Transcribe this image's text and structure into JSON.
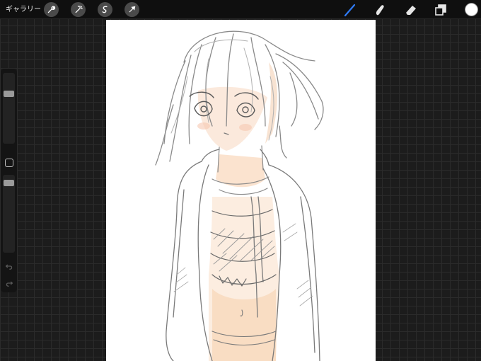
{
  "app": {
    "gallery_label": "ギャラリー"
  },
  "toolbar_left": [
    {
      "name": "actions-icon",
      "icon": "wrench"
    },
    {
      "name": "adjustments-icon",
      "icon": "magic-wand"
    },
    {
      "name": "selection-icon",
      "icon": "s-curve"
    },
    {
      "name": "transform-icon",
      "icon": "arrow"
    }
  ],
  "toolbar_right": [
    {
      "name": "brush-icon",
      "icon": "brush",
      "active": true
    },
    {
      "name": "smudge-icon",
      "icon": "smudge",
      "active": false
    },
    {
      "name": "eraser-icon",
      "icon": "eraser",
      "active": false
    },
    {
      "name": "layers-icon",
      "icon": "layers",
      "active": false
    }
  ],
  "colors": {
    "active_tool": "#2f7bf6",
    "inactive_tool": "#e6e6e6",
    "current_color": "#ffffff",
    "panel_bg": "#0f0f0f",
    "workspace_bg": "#1c1c1c",
    "canvas_bg": "#ffffff"
  },
  "sidebar": {
    "brush_size_level": 0.72,
    "opacity_level": 0.93
  },
  "canvas": {
    "content": "sketch-of-anime-girl-with-hoodie"
  }
}
